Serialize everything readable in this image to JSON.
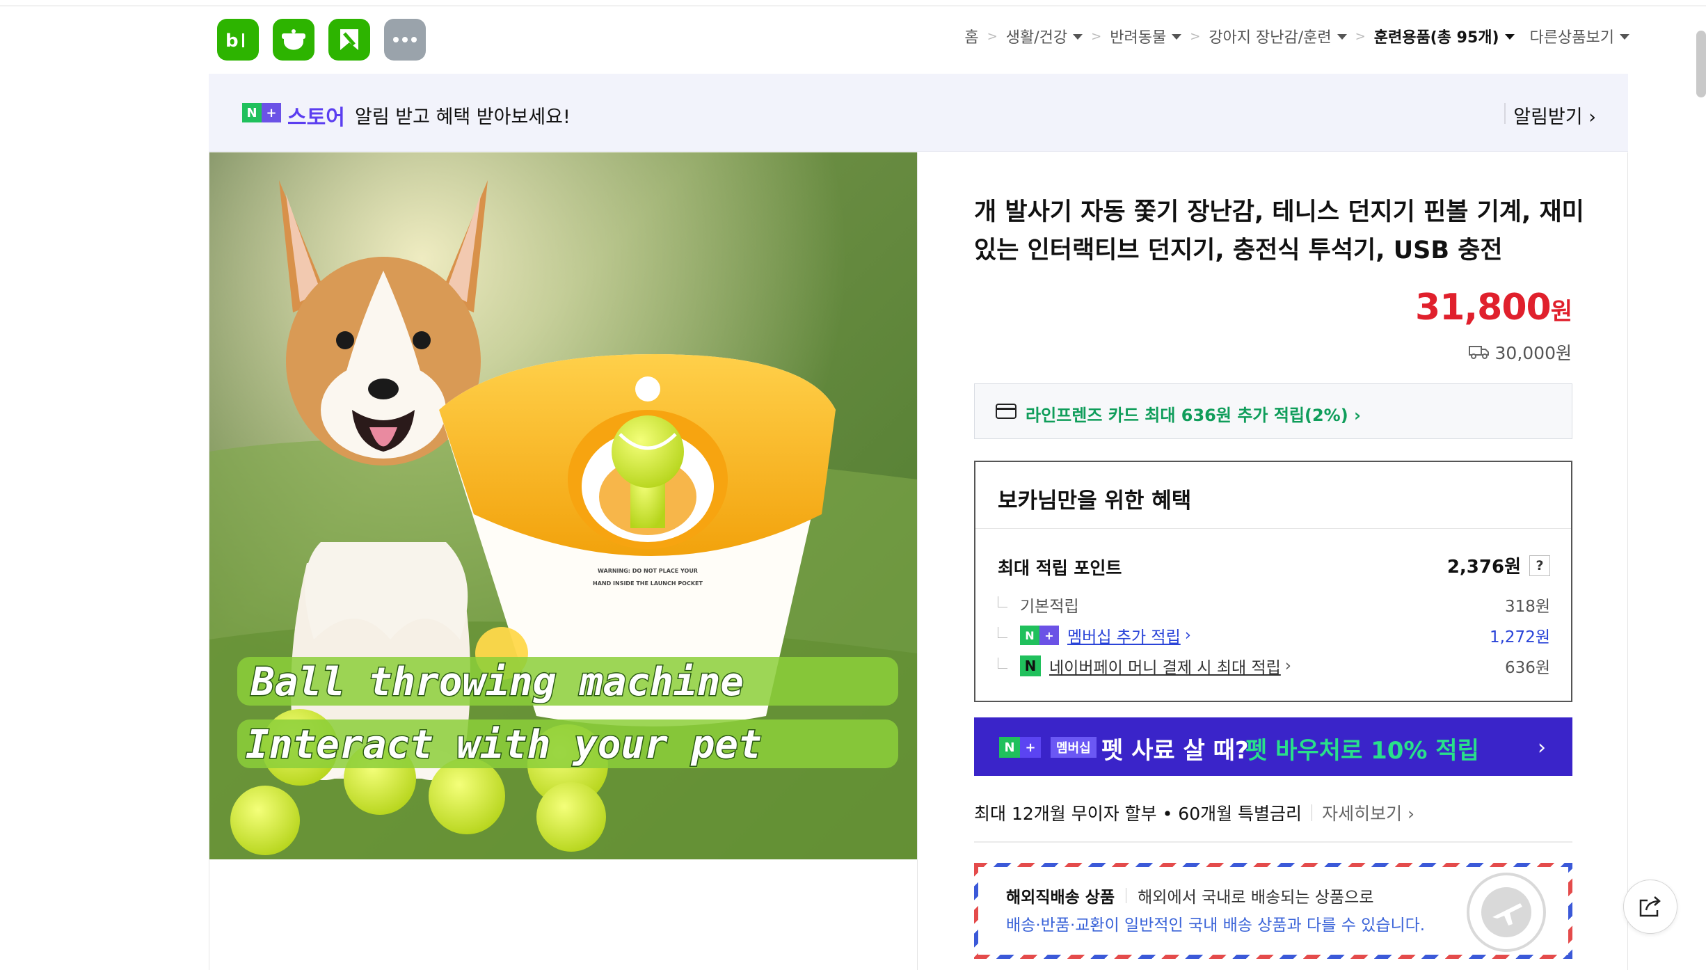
{
  "apps": [
    {
      "name": "blog",
      "label": "b|"
    },
    {
      "name": "cafe",
      "label": ""
    },
    {
      "name": "kin",
      "label": ""
    },
    {
      "name": "more",
      "label": "···"
    }
  ],
  "breadcrumb": {
    "home": "홈",
    "items": [
      "생활/건강",
      "반려동물",
      "강아지 장난감/훈련",
      "훈련용품(총 95개)"
    ],
    "other": "다른상품보기",
    "separator": ">"
  },
  "store_banner": {
    "badge_n": "N",
    "badge_plus": "+",
    "store": "스토어",
    "message": "알림 받고 혜택 받아보세요!",
    "action": "알림받기 ›"
  },
  "product": {
    "image_text": {
      "line1": "Ball throwing machine",
      "line2": "Interact with your pet",
      "warning1": "WARNING: DO NOT PLACE YOUR",
      "warning2": "HAND INSIDE THE LAUNCH POCKET"
    },
    "title": "개 발사기 자동 쫓기 장난감, 테니스 던지기 핀볼 기계, 재미있는 인터랙티브 던지기, 충전식 투석기, USB 충전",
    "price": "31,800",
    "price_unit": "원",
    "shipping": "30,000원"
  },
  "card_promo": "라인프렌즈 카드 최대 636원 추가 적립(2%) ›",
  "benefit": {
    "heading": "보카님만을 위한 혜택",
    "max_point_label": "최대 적립 포인트",
    "max_point_value": "2,376원",
    "help": "?",
    "basic_label": "기본적립",
    "basic_value": "318원",
    "membership_label": "멤버십 추가 적립",
    "membership_value": "1,272원",
    "npay_label": "네이버페이 머니 결제 시 최대 적립",
    "npay_value": "636원",
    "npay_badge": "N"
  },
  "pet_bar": {
    "membership": "멤버십",
    "text1": "펫 사료 살 때?",
    "text2": "펫 바우처로 10% 적립",
    "chevron": "›"
  },
  "installment": {
    "text": "최대 12개월 무이자 할부 • 60개월 특별금리",
    "more": "자세히보기 ›"
  },
  "overseas": {
    "title": "해외직배송 상품",
    "desc": "해외에서 국내로 배송되는 상품으로",
    "note": "배송·반품·교환이 일반적인 국내 배송 상품과 다를 수 있습니다."
  },
  "colors": {
    "naver_green": "#20c05c",
    "price_red": "#e0202c",
    "purple": "#3a24c9",
    "promo_green": "#0f9d5a"
  }
}
